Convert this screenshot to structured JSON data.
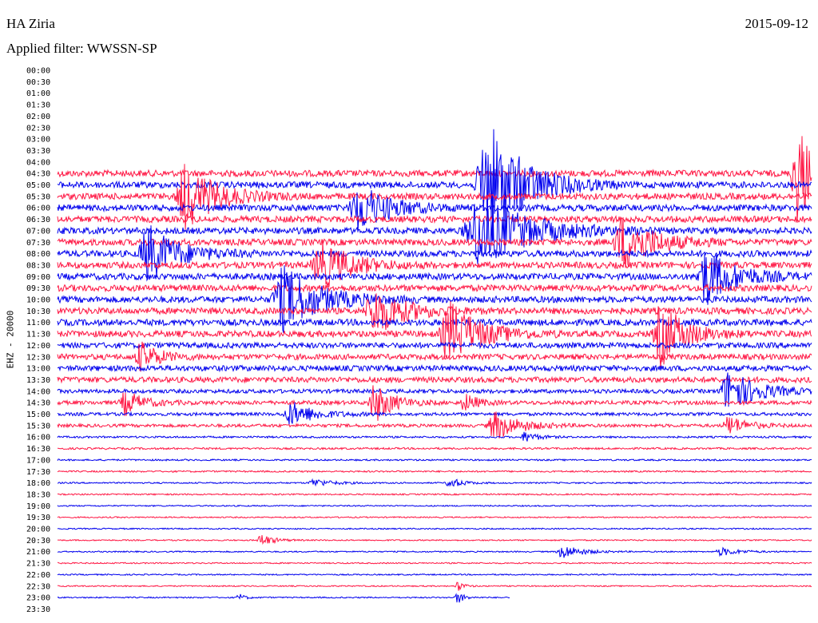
{
  "header": {
    "station": "HA Ziria",
    "date": "2015-09-12",
    "filter": "Applied filter: WWSSN-SP",
    "channel": "EHZ - 20000"
  },
  "colors": {
    "blue": "#0000ee",
    "red": "#ff1744"
  },
  "chart_data": {
    "type": "line",
    "title": "HA Ziria",
    "subtitle": "Applied filter: WWSSN-SP",
    "ylabel": "EHZ - 20000",
    "y_tick_labels": [
      "00:00",
      "00:30",
      "01:00",
      "01:30",
      "02:00",
      "02:30",
      "03:00",
      "03:30",
      "04:00",
      "04:30",
      "05:00",
      "05:30",
      "06:00",
      "06:30",
      "07:00",
      "07:30",
      "08:00",
      "08:30",
      "09:00",
      "09:30",
      "10:00",
      "10:30",
      "11:00",
      "11:30",
      "12:00",
      "12:30",
      "13:00",
      "13:30",
      "14:00",
      "14:30",
      "15:00",
      "15:30",
      "16:00",
      "16:30",
      "17:00",
      "17:30",
      "18:00",
      "18:30",
      "19:00",
      "19:30",
      "20:00",
      "20:30",
      "21:00",
      "21:30",
      "22:00",
      "22:30",
      "23:00",
      "23:30"
    ],
    "trace_colors_alternating": [
      "red",
      "blue"
    ],
    "recorded_traces_start": "04:30",
    "last_trace": "23:00",
    "last_trace_end_fraction": 0.6,
    "noise_level_by_hour": [
      0,
      0,
      0,
      0,
      4,
      4,
      4,
      4,
      4,
      4,
      4,
      4,
      3.5,
      3.5,
      2.5,
      2,
      1.2,
      1,
      0.9,
      0.8,
      0.8,
      0.8,
      0.8,
      0.8
    ],
    "events": [
      {
        "time": "04:00",
        "x": 0.26,
        "width": 0.04,
        "amp": 55
      },
      {
        "time": "04:30",
        "x": 0.98,
        "width": 0.03,
        "amp": 65
      },
      {
        "time": "05:00",
        "x": 0.57,
        "width": 0.06,
        "amp": 80
      },
      {
        "time": "04:00",
        "x": 0.5,
        "width": 0.05,
        "amp": 28
      },
      {
        "time": "05:30",
        "x": 0.17,
        "width": 0.05,
        "amp": 40
      },
      {
        "time": "06:00",
        "x": 0.4,
        "width": 0.05,
        "amp": 30
      },
      {
        "time": "07:00",
        "x": 0.56,
        "width": 0.08,
        "amp": 45
      },
      {
        "time": "07:30",
        "x": 0.75,
        "width": 0.05,
        "amp": 35
      },
      {
        "time": "08:00",
        "x": 0.12,
        "width": 0.05,
        "amp": 35
      },
      {
        "time": "08:30",
        "x": 0.35,
        "width": 0.05,
        "amp": 30
      },
      {
        "time": "09:00",
        "x": 0.86,
        "width": 0.05,
        "amp": 35
      },
      {
        "time": "10:00",
        "x": 0.3,
        "width": 0.06,
        "amp": 40
      },
      {
        "time": "10:30",
        "x": 0.42,
        "width": 0.05,
        "amp": 30
      },
      {
        "time": "11:30",
        "x": 0.52,
        "width": 0.05,
        "amp": 40
      },
      {
        "time": "11:30",
        "x": 0.8,
        "width": 0.04,
        "amp": 40
      },
      {
        "time": "12:30",
        "x": 0.11,
        "width": 0.03,
        "amp": 18
      },
      {
        "time": "14:00",
        "x": 0.89,
        "width": 0.05,
        "amp": 25
      },
      {
        "time": "14:30",
        "x": 0.09,
        "width": 0.03,
        "amp": 15
      },
      {
        "time": "14:30",
        "x": 0.42,
        "width": 0.03,
        "amp": 25
      },
      {
        "time": "14:30",
        "x": 0.54,
        "width": 0.02,
        "amp": 12
      },
      {
        "time": "15:00",
        "x": 0.31,
        "width": 0.04,
        "amp": 15
      },
      {
        "time": "15:30",
        "x": 0.58,
        "width": 0.04,
        "amp": 18
      },
      {
        "time": "15:30",
        "x": 0.89,
        "width": 0.03,
        "amp": 12
      },
      {
        "time": "16:00",
        "x": 0.62,
        "width": 0.02,
        "amp": 7
      },
      {
        "time": "18:00",
        "x": 0.34,
        "width": 0.03,
        "amp": 5
      },
      {
        "time": "18:00",
        "x": 0.52,
        "width": 0.02,
        "amp": 7
      },
      {
        "time": "20:30",
        "x": 0.27,
        "width": 0.02,
        "amp": 8
      },
      {
        "time": "21:00",
        "x": 0.67,
        "width": 0.03,
        "amp": 9
      },
      {
        "time": "21:00",
        "x": 0.88,
        "width": 0.03,
        "amp": 5
      },
      {
        "time": "22:30",
        "x": 0.53,
        "width": 0.01,
        "amp": 7
      },
      {
        "time": "23:00",
        "x": 0.24,
        "width": 0.01,
        "amp": 5
      },
      {
        "time": "23:00",
        "x": 0.53,
        "width": 0.01,
        "amp": 9
      }
    ]
  }
}
